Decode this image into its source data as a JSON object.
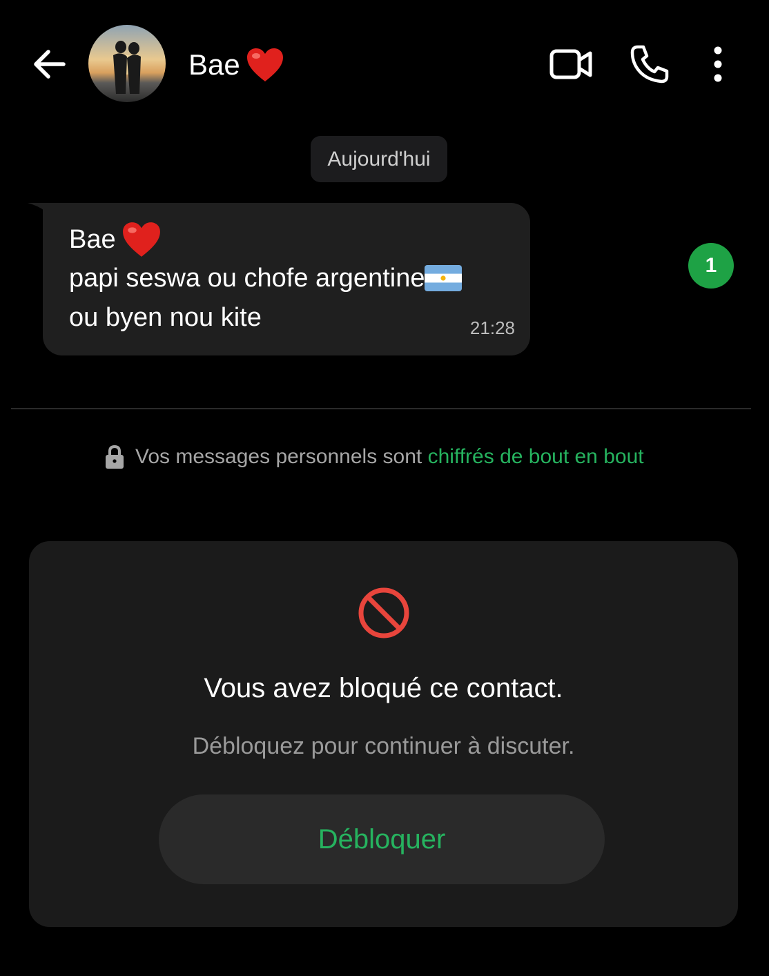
{
  "header": {
    "contact_name": "Bae",
    "name_emoji_icon": "red-heart-icon",
    "avatar_icon": "couple-sunset-avatar",
    "back_icon": "arrow-left-icon",
    "video_icon": "video-camera-icon",
    "call_icon": "phone-icon",
    "more_icon": "more-vertical-icon"
  },
  "chat": {
    "date_label": "Aujourd'hui",
    "message": {
      "sender": "Bae",
      "sender_emoji_icon": "red-heart-icon",
      "line1": "papi seswa ou chofe argentine",
      "line1_emoji_icon": "argentina-flag-icon",
      "line2": "ou byen nou kite",
      "time": "21:28"
    },
    "unread_count": "1"
  },
  "encryption": {
    "text": "Vos messages personnels sont ",
    "link": "chiffrés de bout en bout",
    "icon": "lock-icon"
  },
  "blocked": {
    "icon": "block-icon",
    "title": "Vous avez bloqué ce contact.",
    "subtitle": "Débloquez pour continuer à discuter.",
    "button_label": "Débloquer"
  },
  "colors": {
    "background": "#000000",
    "bubble": "#1f1f1f",
    "accent_green": "#26b35f",
    "badge_green": "#1ea245",
    "block_red": "#e8453c"
  }
}
